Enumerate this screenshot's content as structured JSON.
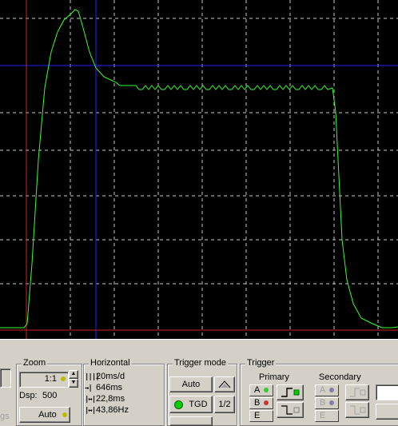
{
  "scope": {
    "colors": {
      "background": "#000000",
      "grid": "#c8c8c8",
      "trace": "#33ff33",
      "cursor_red": "#cc2222",
      "cursor_blue": "#2020ff"
    }
  },
  "zoom": {
    "title": "Zoom",
    "ratio": "1:1",
    "dsp_label": "Dsp:",
    "dsp_value": "500",
    "auto_label": "Auto"
  },
  "horizontal": {
    "title": "Horizontal",
    "rows": [
      {
        "icon": "timebase-icon",
        "glyph": "||||",
        "value": "20ms/d"
      },
      {
        "icon": "position-icon",
        "glyph": "→|",
        "value": "646ms"
      },
      {
        "icon": "period-icon",
        "glyph": "|↔|",
        "value": "22,8ms"
      },
      {
        "icon": "frequency-icon",
        "glyph": "|↔|",
        "value": "43,86Hz"
      }
    ]
  },
  "trigger_mode": {
    "title": "Trigger mode",
    "auto_label": "Auto",
    "tgd_label": "TGD",
    "half_label": "1/2"
  },
  "trigger": {
    "title": "Trigger",
    "primary_label": "Primary",
    "secondary_label": "Secondary",
    "primary_channels": [
      {
        "label": "A",
        "color": "#33cc33"
      },
      {
        "label": "B",
        "color": "#cc3333"
      },
      {
        "label": "E",
        "color": ""
      }
    ],
    "secondary_channels": [
      {
        "label": "A",
        "color": "#8080a0"
      },
      {
        "label": "B",
        "color": "#8080a0"
      },
      {
        "label": "E",
        "color": ""
      }
    ]
  }
}
